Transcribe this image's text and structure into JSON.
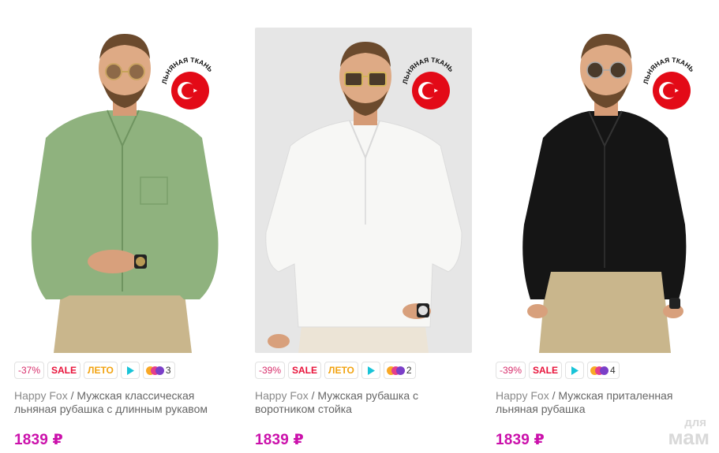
{
  "products": [
    {
      "badges": {
        "discount": "-37%",
        "sale": "SALE",
        "summer": "ЛЕТО",
        "colors_count": "3"
      },
      "flag_label": "ЛЬНЯНАЯ ТКАНЬ",
      "brand": "Happy Fox",
      "separator": " / ",
      "name": "Мужская классическая льняная рубашка с длинным рукавом",
      "price": "1839 ₽",
      "shirt_color": "#8fb27e"
    },
    {
      "badges": {
        "discount": "-39%",
        "sale": "SALE",
        "summer": "ЛЕТО",
        "colors_count": "2"
      },
      "flag_label": "ЛЬНЯНАЯ ТКАНЬ",
      "brand": "Happy Fox",
      "separator": " / ",
      "name": "Мужская рубашка с воротником стойка",
      "price": "1839 ₽",
      "shirt_color": "#f7f7f5"
    },
    {
      "badges": {
        "discount": "-39%",
        "sale": "SALE",
        "colors_count": "4"
      },
      "flag_label": "ЛЬНЯНАЯ ТКАНЬ",
      "brand": "Happy Fox",
      "separator": " / ",
      "name": "Мужская приталенная льняная рубашка",
      "price": "1839 ₽",
      "shirt_color": "#151515"
    }
  ],
  "watermark": {
    "line1": "для",
    "line2": "мам"
  },
  "colors": {
    "price": "#cb11ab",
    "sale": "#e8123a",
    "summer": "#f2a311",
    "discount": "#d72d6b",
    "video": "#19c4d8",
    "flag_red": "#e30a17"
  },
  "icons": {
    "video": "play-triangle-icon",
    "colors": "color-swatches-icon",
    "flag": "turkey-flag-icon"
  }
}
